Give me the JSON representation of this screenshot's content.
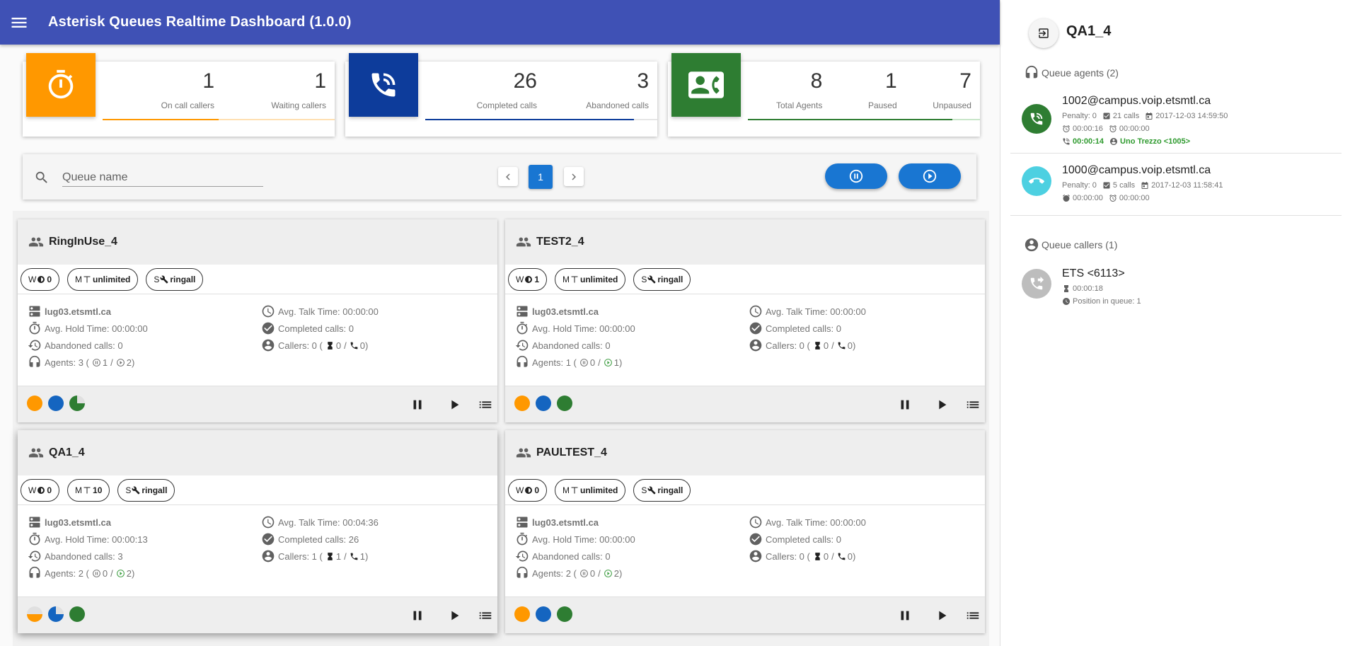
{
  "app": {
    "title": "Asterisk Queues Realtime Dashboard (1.0.0)"
  },
  "stats": [
    {
      "icon": "timer-icon",
      "color": "#ff9800",
      "items": [
        {
          "value": "1",
          "label": "On call callers"
        },
        {
          "value": "1",
          "label": "Waiting callers"
        }
      ]
    },
    {
      "icon": "phone-in-talk-icon",
      "color": "#0d3c9b",
      "items": [
        {
          "value": "26",
          "label": "Completed calls"
        },
        {
          "value": "3",
          "label": "Abandoned calls"
        }
      ]
    },
    {
      "icon": "contact-phone-icon",
      "color": "#2e7d32",
      "items": [
        {
          "value": "8",
          "label": "Total Agents"
        },
        {
          "value": "1",
          "label": "Paused"
        },
        {
          "value": "7",
          "label": "Unpaused"
        }
      ]
    }
  ],
  "filter": {
    "placeholder": "Queue name",
    "value": "",
    "current_page": "1"
  },
  "queues": [
    {
      "name": "RingInUse_4",
      "chips": {
        "weight_key": "W",
        "weight": "0",
        "max_key": "M",
        "max": "unlimited",
        "strategy_key": "S",
        "strategy": "ringall"
      },
      "server": "lug03.etsmtl.ca",
      "hold_time": "Avg. Hold Time: 00:00:00",
      "abandoned": "Abandoned calls: 0",
      "agents_prefix": "Agents: 3 (",
      "agents_paused": "1",
      "agents_active": "2",
      "agents_active_colored": false,
      "talk_time": "Avg. Talk Time: 00:00:00",
      "completed": "Completed calls: 0",
      "callers_prefix": "Callers: 0 (",
      "callers_waiting": "0",
      "callers_oncall": "0",
      "dots": [
        "full",
        "full",
        "pie"
      ]
    },
    {
      "name": "TEST2_4",
      "chips": {
        "weight_key": "W",
        "weight": "1",
        "max_key": "M",
        "max": "unlimited",
        "strategy_key": "S",
        "strategy": "ringall"
      },
      "server": "lug03.etsmtl.ca",
      "hold_time": "Avg. Hold Time: 00:00:00",
      "abandoned": "Abandoned calls: 0",
      "agents_prefix": "Agents: 1 (",
      "agents_paused": "0",
      "agents_active": "1",
      "agents_active_colored": true,
      "talk_time": "Avg. Talk Time: 00:00:00",
      "completed": "Completed calls: 0",
      "callers_prefix": "Callers: 0 (",
      "callers_waiting": "0",
      "callers_oncall": "0",
      "dots": [
        "full",
        "full",
        "full"
      ]
    },
    {
      "name": "QA1_4",
      "chips": {
        "weight_key": "W",
        "weight": "0",
        "max_key": "M",
        "max": "10",
        "strategy_key": "S",
        "strategy": "ringall"
      },
      "server": "lug03.etsmtl.ca",
      "hold_time": "Avg. Hold Time: 00:00:13",
      "abandoned": "Abandoned calls: 3",
      "agents_prefix": "Agents: 2 (",
      "agents_paused": "0",
      "agents_active": "2",
      "agents_active_colored": true,
      "talk_time": "Avg. Talk Time: 00:04:36",
      "completed": "Completed calls: 26",
      "callers_prefix": "Callers: 1 (",
      "callers_waiting": "1",
      "callers_oncall": "1",
      "dots": [
        "half",
        "pie",
        "full"
      ]
    },
    {
      "name": "PAULTEST_4",
      "chips": {
        "weight_key": "W",
        "weight": "0",
        "max_key": "M",
        "max": "unlimited",
        "strategy_key": "S",
        "strategy": "ringall"
      },
      "server": "lug03.etsmtl.ca",
      "hold_time": "Avg. Hold Time: 00:00:00",
      "abandoned": "Abandoned calls: 0",
      "agents_prefix": "Agents: 2 (",
      "agents_paused": "0",
      "agents_active": "2",
      "agents_active_colored": true,
      "talk_time": "Avg. Talk Time: 00:00:00",
      "completed": "Completed calls: 0",
      "callers_prefix": "Callers: 0 (",
      "callers_waiting": "0",
      "callers_oncall": "0",
      "dots": [
        "full",
        "full",
        "full"
      ]
    }
  ],
  "colors": {
    "orange": "#ff9800",
    "blue": "#1565c0",
    "green": "#2e7d32",
    "appbar": "#3f51b5",
    "accent": "#1976d2"
  },
  "drawer": {
    "title": "QA1_4",
    "agents_label": "Queue agents (2)",
    "agents": [
      {
        "name": "1002@campus.voip.etsmtl.ca",
        "status": "in-call",
        "penalty": "Penalty: 0",
        "calls": "21 calls",
        "last_call": "2017-12-03 14:59:50",
        "time_a": "00:00:16",
        "time_b": "00:00:00",
        "call_duration": "00:00:14",
        "call_with": "Uno Trezzo <1005>"
      },
      {
        "name": "1000@campus.voip.etsmtl.ca",
        "status": "idle",
        "penalty": "Penalty: 0",
        "calls": "5 calls",
        "last_call": "2017-12-03 11:58:41",
        "time_a": "00:00:00",
        "time_b": "00:00:00"
      }
    ],
    "callers_label": "Queue callers (1)",
    "callers": [
      {
        "name": "ETS <6113>",
        "wait": "00:00:18",
        "position": "Position in queue: 1"
      }
    ]
  }
}
